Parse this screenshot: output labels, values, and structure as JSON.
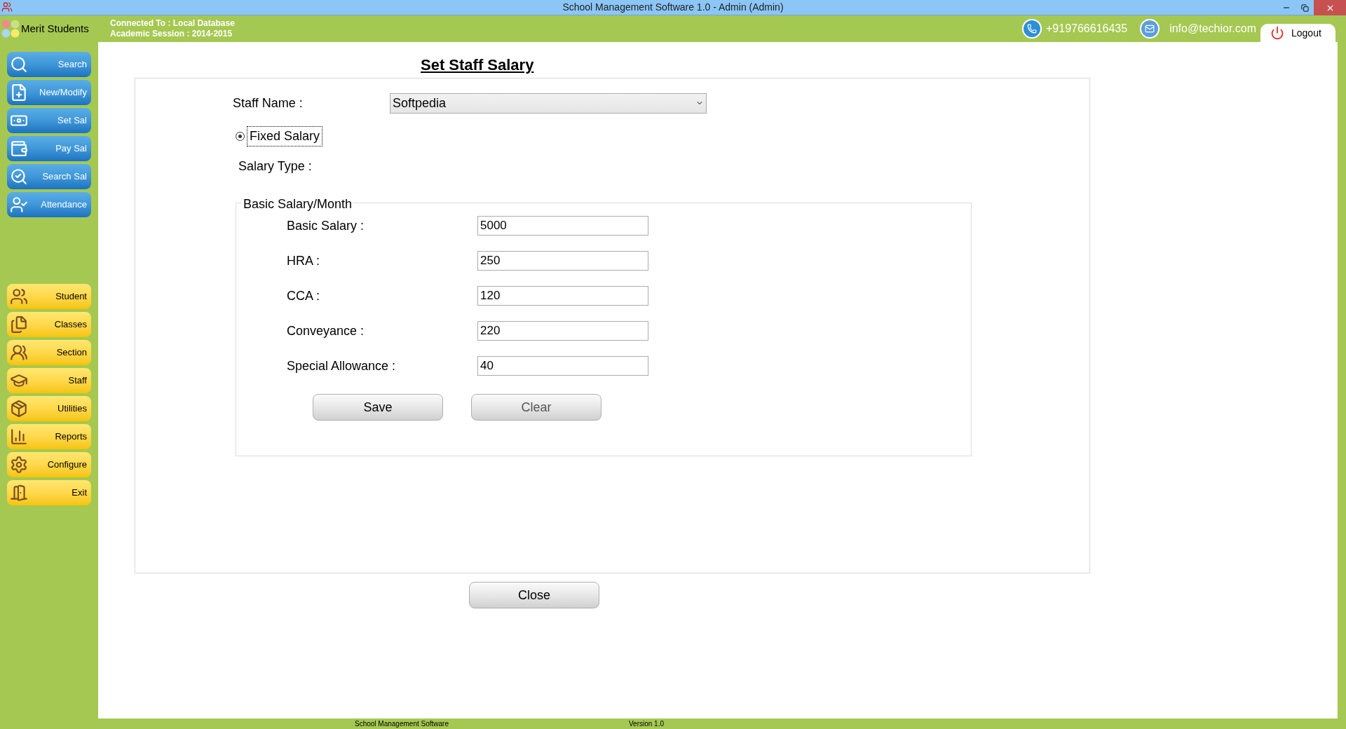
{
  "window": {
    "title": "School Management Software 1.0  -  Admin (Admin)"
  },
  "header": {
    "app_name": "Merit Students",
    "connection": "Connected To : Local Database",
    "session": "Academic Session : 2014-2015",
    "phone": "+919766616435",
    "email": "info@techior.com",
    "logout": "Logout"
  },
  "sidebar": {
    "top_items": [
      {
        "label": "Search"
      },
      {
        "label": "New/Modify"
      },
      {
        "label": "Set Sal"
      },
      {
        "label": "Pay Sal"
      },
      {
        "label": "Search Sal"
      },
      {
        "label": "Attendance"
      }
    ],
    "bottom_items": [
      {
        "label": "Student"
      },
      {
        "label": "Classes"
      },
      {
        "label": "Section"
      },
      {
        "label": "Staff"
      },
      {
        "label": "Utilities"
      },
      {
        "label": "Reports"
      },
      {
        "label": "Configure"
      },
      {
        "label": "Exit"
      }
    ]
  },
  "page_title": "Set Staff Salary",
  "form": {
    "staff_name": {
      "label": "Staff Name :",
      "value": "Softpedia"
    },
    "salary_option": {
      "label": "Fixed Salary",
      "selected": true
    },
    "salary_type_label": "Salary Type :",
    "group": {
      "title": "Basic Salary/Month",
      "fields": [
        {
          "label": "Basic Salary :",
          "value": "5000"
        },
        {
          "label": "HRA :",
          "value": "250"
        },
        {
          "label": "CCA :",
          "value": "120"
        },
        {
          "label": "Conveyance :",
          "value": "220"
        },
        {
          "label": "Special Allowance :",
          "value": "40"
        }
      ]
    },
    "buttons": [
      "Save",
      "Clear"
    ]
  },
  "close_button": "Close",
  "status_bar": [
    "School Management Software",
    "Version 1.0"
  ]
}
